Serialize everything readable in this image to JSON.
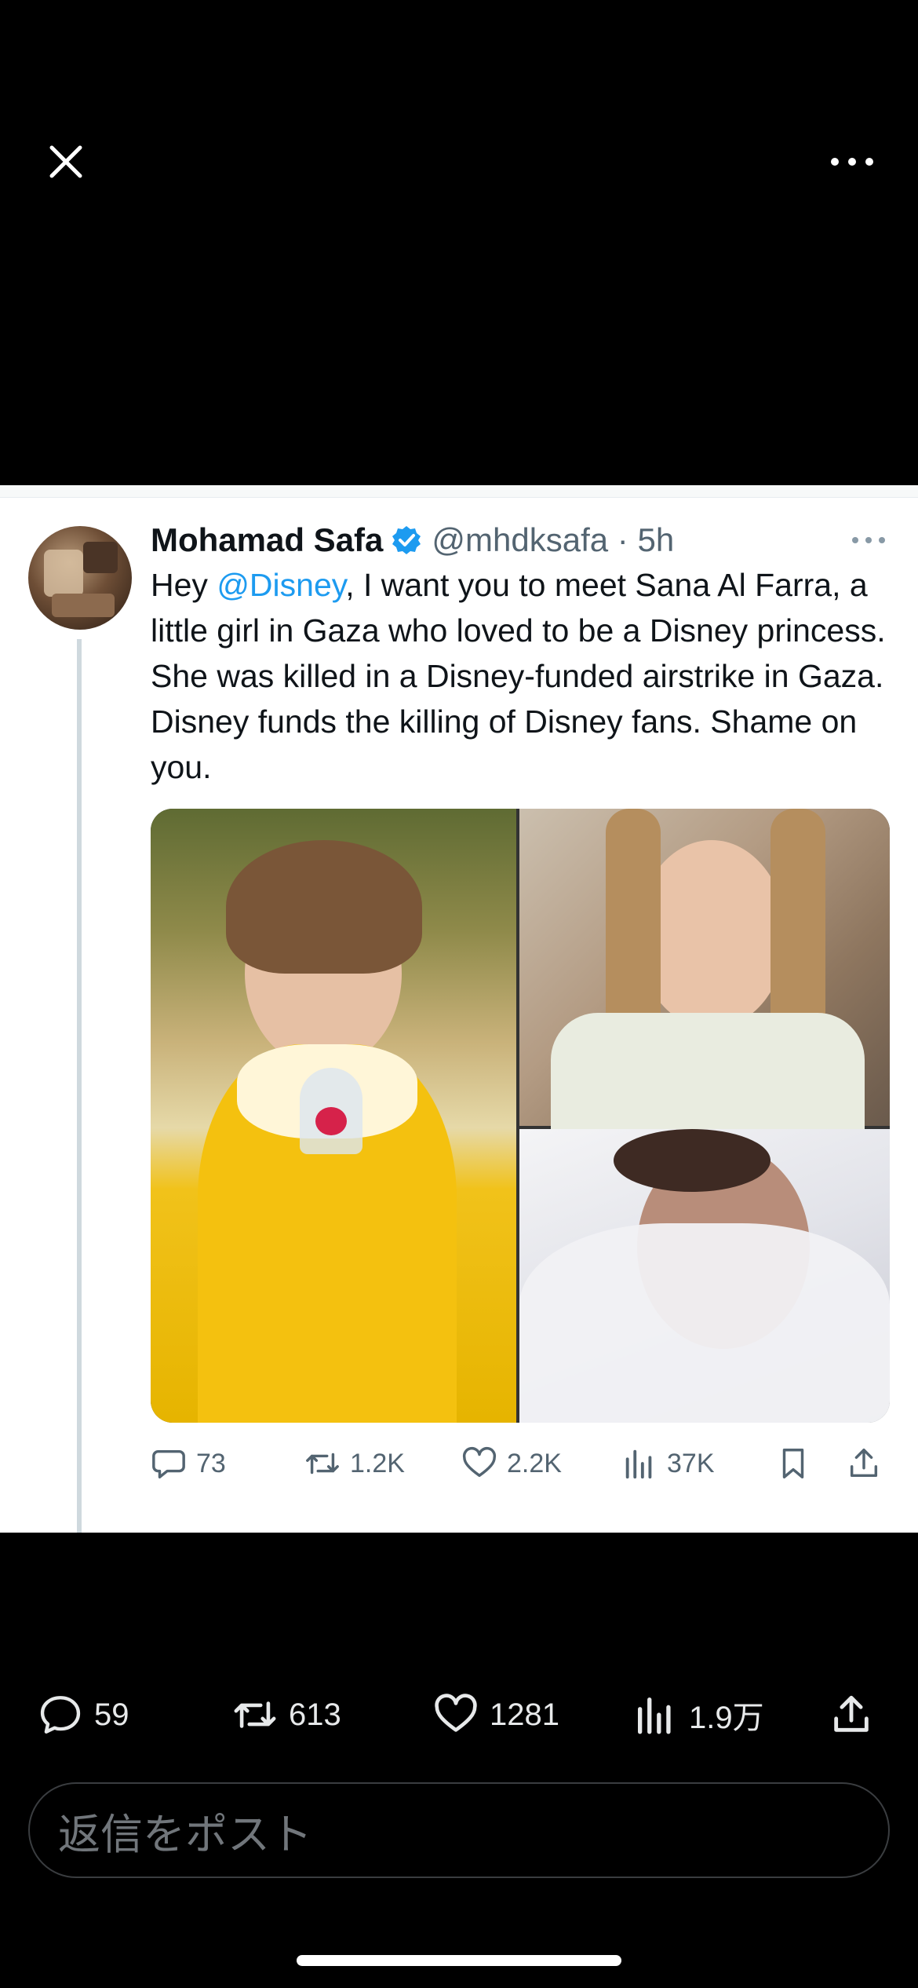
{
  "tweet": {
    "author_name": "Mohamad Safa",
    "handle_time": "@mhdksafa · 5h",
    "text_prefix": "Hey ",
    "mention": "@Disney",
    "text_body": ", I want you to meet Sana Al Farra, a little girl in Gaza who loved to be a Disney princess. She was killed in a Disney-funded airstrike in Gaza. Disney funds the killing of Disney fans. Shame on you.",
    "stats": {
      "replies": "73",
      "retweets": "1.2K",
      "likes": "2.2K",
      "views": "37K"
    }
  },
  "post_stats": {
    "replies": "59",
    "retweets": "613",
    "likes": "1281",
    "views": "1.9万"
  },
  "reply": {
    "placeholder": "返信をポスト"
  },
  "colors": {
    "background": "#000000",
    "card_background": "#ffffff",
    "link_blue": "#1d9bf0",
    "secondary_text": "#536471"
  }
}
